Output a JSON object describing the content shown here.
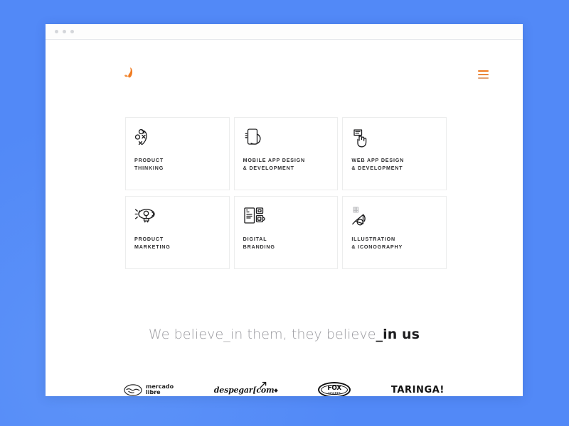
{
  "window": {
    "titlebar_dots": [
      "dot-1",
      "dot-2",
      "dot-3"
    ]
  },
  "header": {
    "logo_name": "brand-droplet-logo",
    "menu_name": "hamburger-menu-icon",
    "accent_color": "#f07c22"
  },
  "services": [
    {
      "icon": "strategy-playbook-icon",
      "title": "PRODUCT\nTHINKING"
    },
    {
      "icon": "hand-holding-phone-icon",
      "title": "MOBILE APP DESIGN\n& DEVELOPMENT"
    },
    {
      "icon": "pointing-hand-cursor-icon",
      "title": "WEB APP DESIGN\n& DEVELOPMENT"
    },
    {
      "icon": "zeppelin-airship-icon",
      "title": "PRODUCT\nMARKETING"
    },
    {
      "icon": "stationery-brand-collateral-icon",
      "title": "DIGITAL\nBRANDING"
    },
    {
      "icon": "pen-nib-illustration-icon",
      "title": "ILLUSTRATION\n& ICONOGRAPHY"
    }
  ],
  "tagline": {
    "lead": "We believe_in them, they believe",
    "accent": "_in us"
  },
  "clients": [
    {
      "name": "mercado-libre",
      "line1": "mercado",
      "line2": "libre"
    },
    {
      "name": "despegar-com",
      "label": "despegar[com"
    },
    {
      "name": "fox-sports",
      "word": "FOX",
      "sub": "SPORTS"
    },
    {
      "name": "taringa",
      "label": "TARINGA!"
    }
  ],
  "colors": {
    "page_background": "#5289f7",
    "card_border": "#eceded",
    "text_dark": "#2d2d2f",
    "text_muted": "#9b9ba0"
  }
}
